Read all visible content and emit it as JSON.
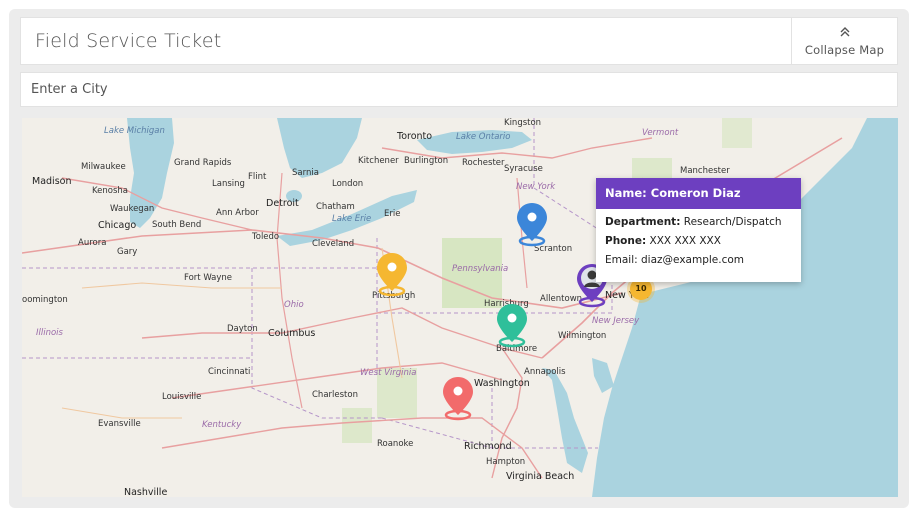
{
  "header": {
    "title": "Field Service Ticket",
    "collapse_label": "Collapse Map"
  },
  "search": {
    "placeholder": "Enter a City"
  },
  "popup": {
    "name_label": "Name: Comeron Diaz",
    "department_key": "Department:",
    "department_value": "Research/Dispatch",
    "phone_key": "Phone:",
    "phone_value": "XXX XXX XXX",
    "email_key": "Email:",
    "email_value": "diaz@example.com"
  },
  "cluster": {
    "count": "10"
  },
  "markers": {
    "blue": "#3c86d9",
    "orange": "#f5b731",
    "teal": "#2fbf9a",
    "red": "#f26b6b",
    "purple": "#6d3fc0"
  },
  "map_labels": [
    "Lake Michigan",
    "Milwaukee",
    "Madison",
    "Grand Rapids",
    "Kenosha",
    "Waukegan",
    "Lansing",
    "Flint",
    "Sarnia",
    "London",
    "Kitchener",
    "Burlington",
    "Toronto",
    "Lake Ontario",
    "Rochester",
    "Kingston",
    "Syracuse",
    "New York",
    "Manchester",
    "Vermont",
    "Chicago",
    "South Bend",
    "Aurora",
    "Gary",
    "Ann Arbor",
    "Detroit",
    "Toledo",
    "Chatham",
    "Lake Erie",
    "Erie",
    "Cleveland",
    "Fort Wayne",
    "Pennsylvania",
    "Scranton",
    "Pittsburgh",
    "Harrisburg",
    "Allentown",
    "New York",
    "New Jersey",
    "Ohio",
    "Dayton",
    "Columbus",
    "oomington",
    "Illinois",
    "Baltimore",
    "Wilmington",
    "Cincinnati",
    "West Virginia",
    "Washington",
    "Annapolis",
    "Louisville",
    "Charleston",
    "Kentucky",
    "Evansville",
    "Roanoke",
    "Richmond",
    "Hampton",
    "Virginia Beach",
    "Nashville"
  ]
}
